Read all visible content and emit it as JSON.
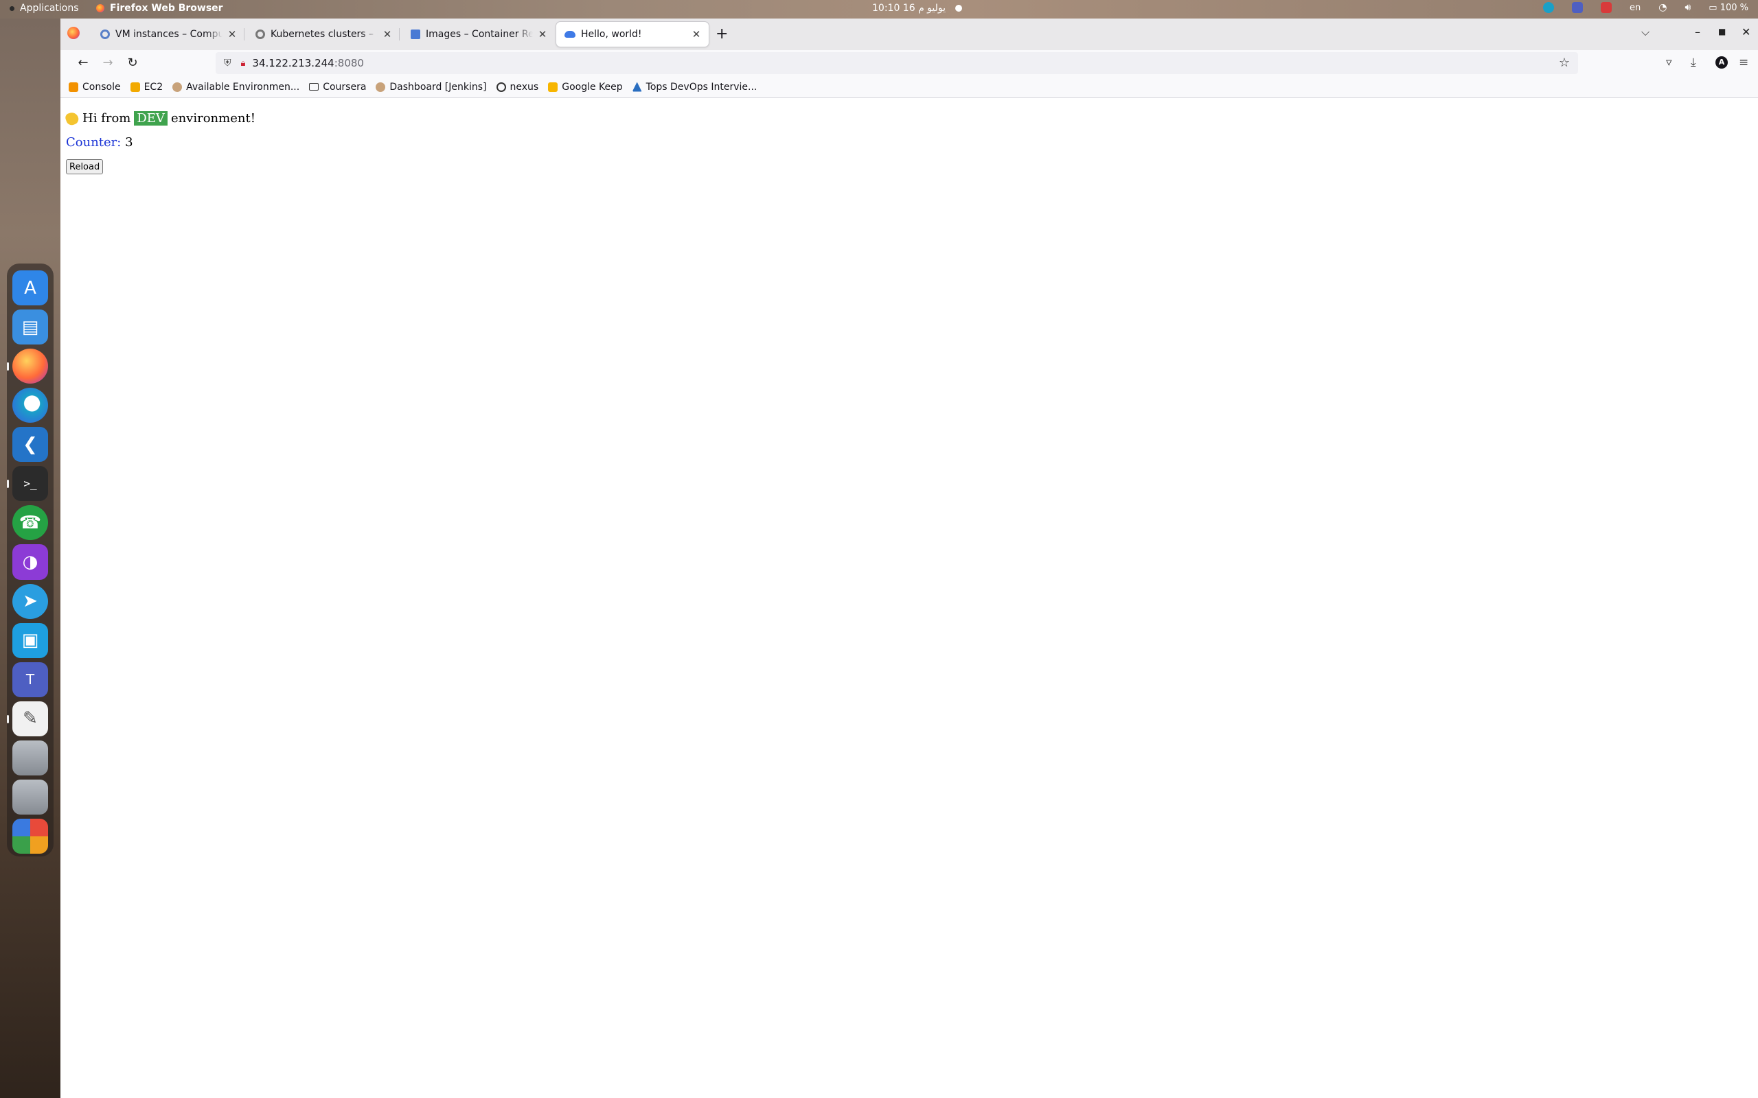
{
  "topbar": {
    "activities": "Applications",
    "app_name": "Firefox Web Browser",
    "clock": "10:10 16 يوليو م",
    "language": "en",
    "battery": "100 %"
  },
  "dock": {
    "items": [
      {
        "icon": "app-store-icon",
        "color": "#2f86e8"
      },
      {
        "icon": "files-icon",
        "color": "#3a8fe0"
      },
      {
        "icon": "firefox-icon",
        "color": "#ff7139"
      },
      {
        "icon": "edge-icon",
        "color": "#1aa0c8"
      },
      {
        "icon": "vscode-icon",
        "color": "#2474c8"
      },
      {
        "icon": "terminal-icon",
        "color": "#2b2b2b"
      },
      {
        "icon": "whatsapp-icon",
        "color": "#25a244"
      },
      {
        "icon": "podcast-icon",
        "color": "#8c3bd6"
      },
      {
        "icon": "telegram-icon",
        "color": "#2a9ee0"
      },
      {
        "icon": "slides-icon",
        "color": "#1e9fe0"
      },
      {
        "icon": "teams-icon",
        "color": "#4e5fc2"
      },
      {
        "icon": "text-editor-icon",
        "color": "#e8e8e8"
      },
      {
        "icon": "disk-icon",
        "color": "#9aa0a6"
      },
      {
        "icon": "disk-icon",
        "color": "#9aa0a6"
      },
      {
        "icon": "apps-grid-icon",
        "color": "#3a3a3a"
      }
    ]
  },
  "tabs": [
    {
      "title": "VM instances – Compute Engine",
      "favicon": "gear-icon"
    },
    {
      "title": "Kubernetes clusters – Kubernetes Engine",
      "favicon": "gear-icon"
    },
    {
      "title": "Images – Container Registry",
      "favicon": "image-icon"
    },
    {
      "title": "Hello, world!",
      "favicon": "cloud-icon",
      "active": true
    }
  ],
  "url": {
    "host": "34.122.213.244",
    "port": ":8080"
  },
  "bookmarks": [
    {
      "label": "Console",
      "icon": "aws-icon"
    },
    {
      "label": "EC2",
      "icon": "ec2-icon"
    },
    {
      "label": "Available Environmen...",
      "icon": "person-icon"
    },
    {
      "label": "Coursera",
      "icon": "folder-icon"
    },
    {
      "label": "Dashboard [Jenkins]",
      "icon": "person-icon"
    },
    {
      "label": "nexus",
      "icon": "nexus-icon"
    },
    {
      "label": "Google Keep",
      "icon": "keep-icon"
    },
    {
      "label": "Tops DevOps Intervie...",
      "icon": "tops-icon"
    }
  ],
  "page": {
    "greeting_prefix": "Hi from",
    "environment": "DEV",
    "greeting_suffix": "environment!",
    "counter_label": "Counter:",
    "counter_value": "3",
    "reload_label": "Reload"
  },
  "colors": {
    "env_badge": "#3fa34d",
    "counter_label": "#1a33d6"
  }
}
